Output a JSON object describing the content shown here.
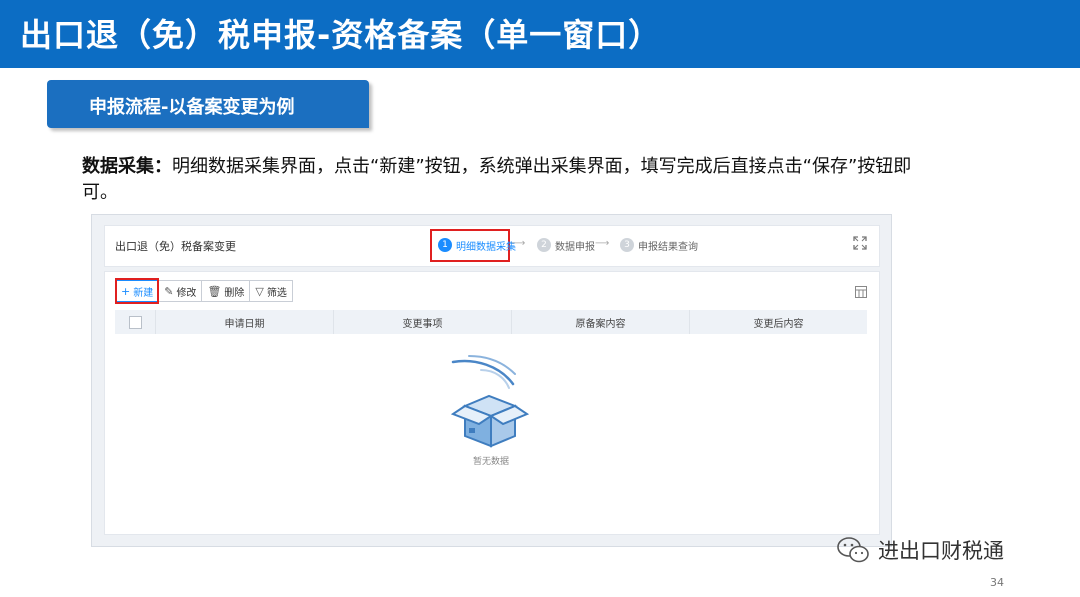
{
  "slide": {
    "title": "出口退（免）税申报-资格备案（单一窗口）",
    "section_label": "申报流程-以备案变更为例",
    "desc_bold": "数据采集：",
    "desc_text": "明细数据采集界面，点击“新建”按钮，系统弹出采集界面，填写完成后直接点击“保存”按钮即可。",
    "watermark": "进出口财税通",
    "page_number": "34"
  },
  "app": {
    "title": "出口退（免）税备案变更",
    "steps": [
      {
        "num": "1",
        "label": "明细数据采集",
        "active": true
      },
      {
        "num": "2",
        "label": "数据申报",
        "active": false
      },
      {
        "num": "3",
        "label": "申报结果查询",
        "active": false
      }
    ],
    "toolbar": {
      "new_label": "新建",
      "edit_label": "修改",
      "delete_label": "删除",
      "filter_label": "筛选"
    },
    "table": {
      "columns": [
        "申请日期",
        "变更事项",
        "原备案内容",
        "变更后内容"
      ],
      "rows": []
    },
    "empty_text": "暂无数据"
  },
  "colors": {
    "banner": "#0c6dc4",
    "section_pill": "#1b6fc0",
    "accent": "#1a8cff",
    "highlight_red": "#e02020"
  }
}
